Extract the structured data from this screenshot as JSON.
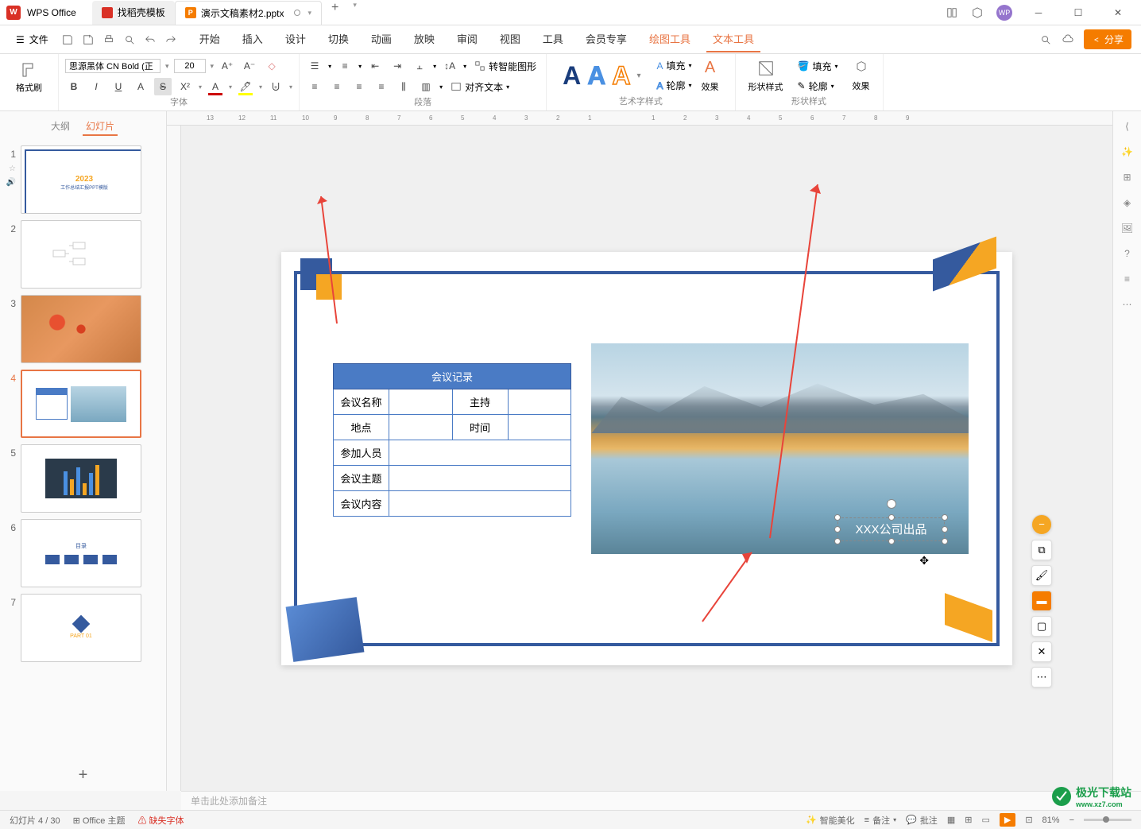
{
  "app": {
    "name": "WPS Office"
  },
  "tabs": {
    "template": "找稻壳模板",
    "active": "演示文稿素材2.pptx"
  },
  "menu": {
    "file": "文件",
    "items": [
      "开始",
      "插入",
      "设计",
      "切换",
      "动画",
      "放映",
      "审阅",
      "视图",
      "工具",
      "会员专享",
      "绘图工具",
      "文本工具"
    ],
    "share": "分享"
  },
  "ribbon": {
    "format_brush": "格式刷",
    "font_name": "思源黑体 CN Bold (正",
    "font_size": "20",
    "group_font": "字体",
    "group_paragraph": "段落",
    "convert_smart": "转智能图形",
    "align_text": "对齐文本",
    "group_wordart": "艺术字样式",
    "fill": "填充",
    "outline": "轮廓",
    "effect": "效果",
    "shape_style": "形状样式",
    "group_shape": "形状样式"
  },
  "panel": {
    "tabs": [
      "大纲",
      "幻灯片"
    ],
    "slide1_title": "2023",
    "slide1_sub": "工作总结汇报PPT模版"
  },
  "slide": {
    "table": {
      "title": "会议记录",
      "rows": [
        [
          "会议名称",
          "",
          "主持",
          ""
        ],
        [
          "地点",
          "",
          "时间",
          ""
        ],
        [
          "参加人员",
          "",
          "",
          ""
        ],
        [
          "会议主题",
          "",
          "",
          ""
        ],
        [
          "会议内容",
          "",
          "",
          ""
        ]
      ]
    },
    "textbox": "XXX公司出品"
  },
  "notes": "单击此处添加备注",
  "status": {
    "slide_info": "幻灯片 4 / 30",
    "theme": "Office 主题",
    "missing_font": "缺失字体",
    "smart_beautify": "智能美化",
    "notes": "备注",
    "comments": "批注",
    "zoom": "81%"
  },
  "watermark": {
    "text": "极光下载站",
    "url": "www.xz7.com"
  }
}
